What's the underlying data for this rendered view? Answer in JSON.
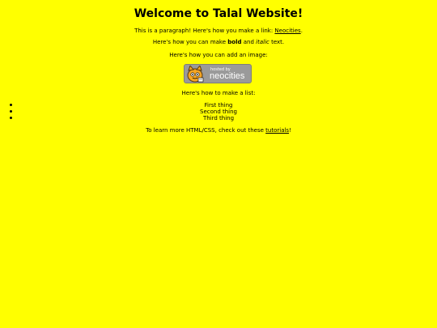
{
  "page": {
    "title": "Welcome to Talal Website!",
    "paragraph_link": {
      "before": "This is a paragraph! Here's how you make a link: ",
      "link_text": "Neocities",
      "after": "."
    },
    "paragraph_format": {
      "before": "Here's how you can make ",
      "bold": "bold",
      "middle": " and ",
      "italic": "italic",
      "after": " text."
    },
    "image_intro": "Here's how you can add an image:",
    "badge": {
      "hosted_by": "hosted by",
      "brand": "neocities"
    },
    "list_intro": "Here's how to make a list:",
    "list_items": [
      "First thing",
      "Second thing",
      "Third thing"
    ],
    "closing": {
      "before": "To learn more HTML/CSS, check out these ",
      "link_text": "tutorials",
      "after": "!"
    }
  },
  "colors": {
    "background": "#ffff00",
    "text": "#000000"
  }
}
